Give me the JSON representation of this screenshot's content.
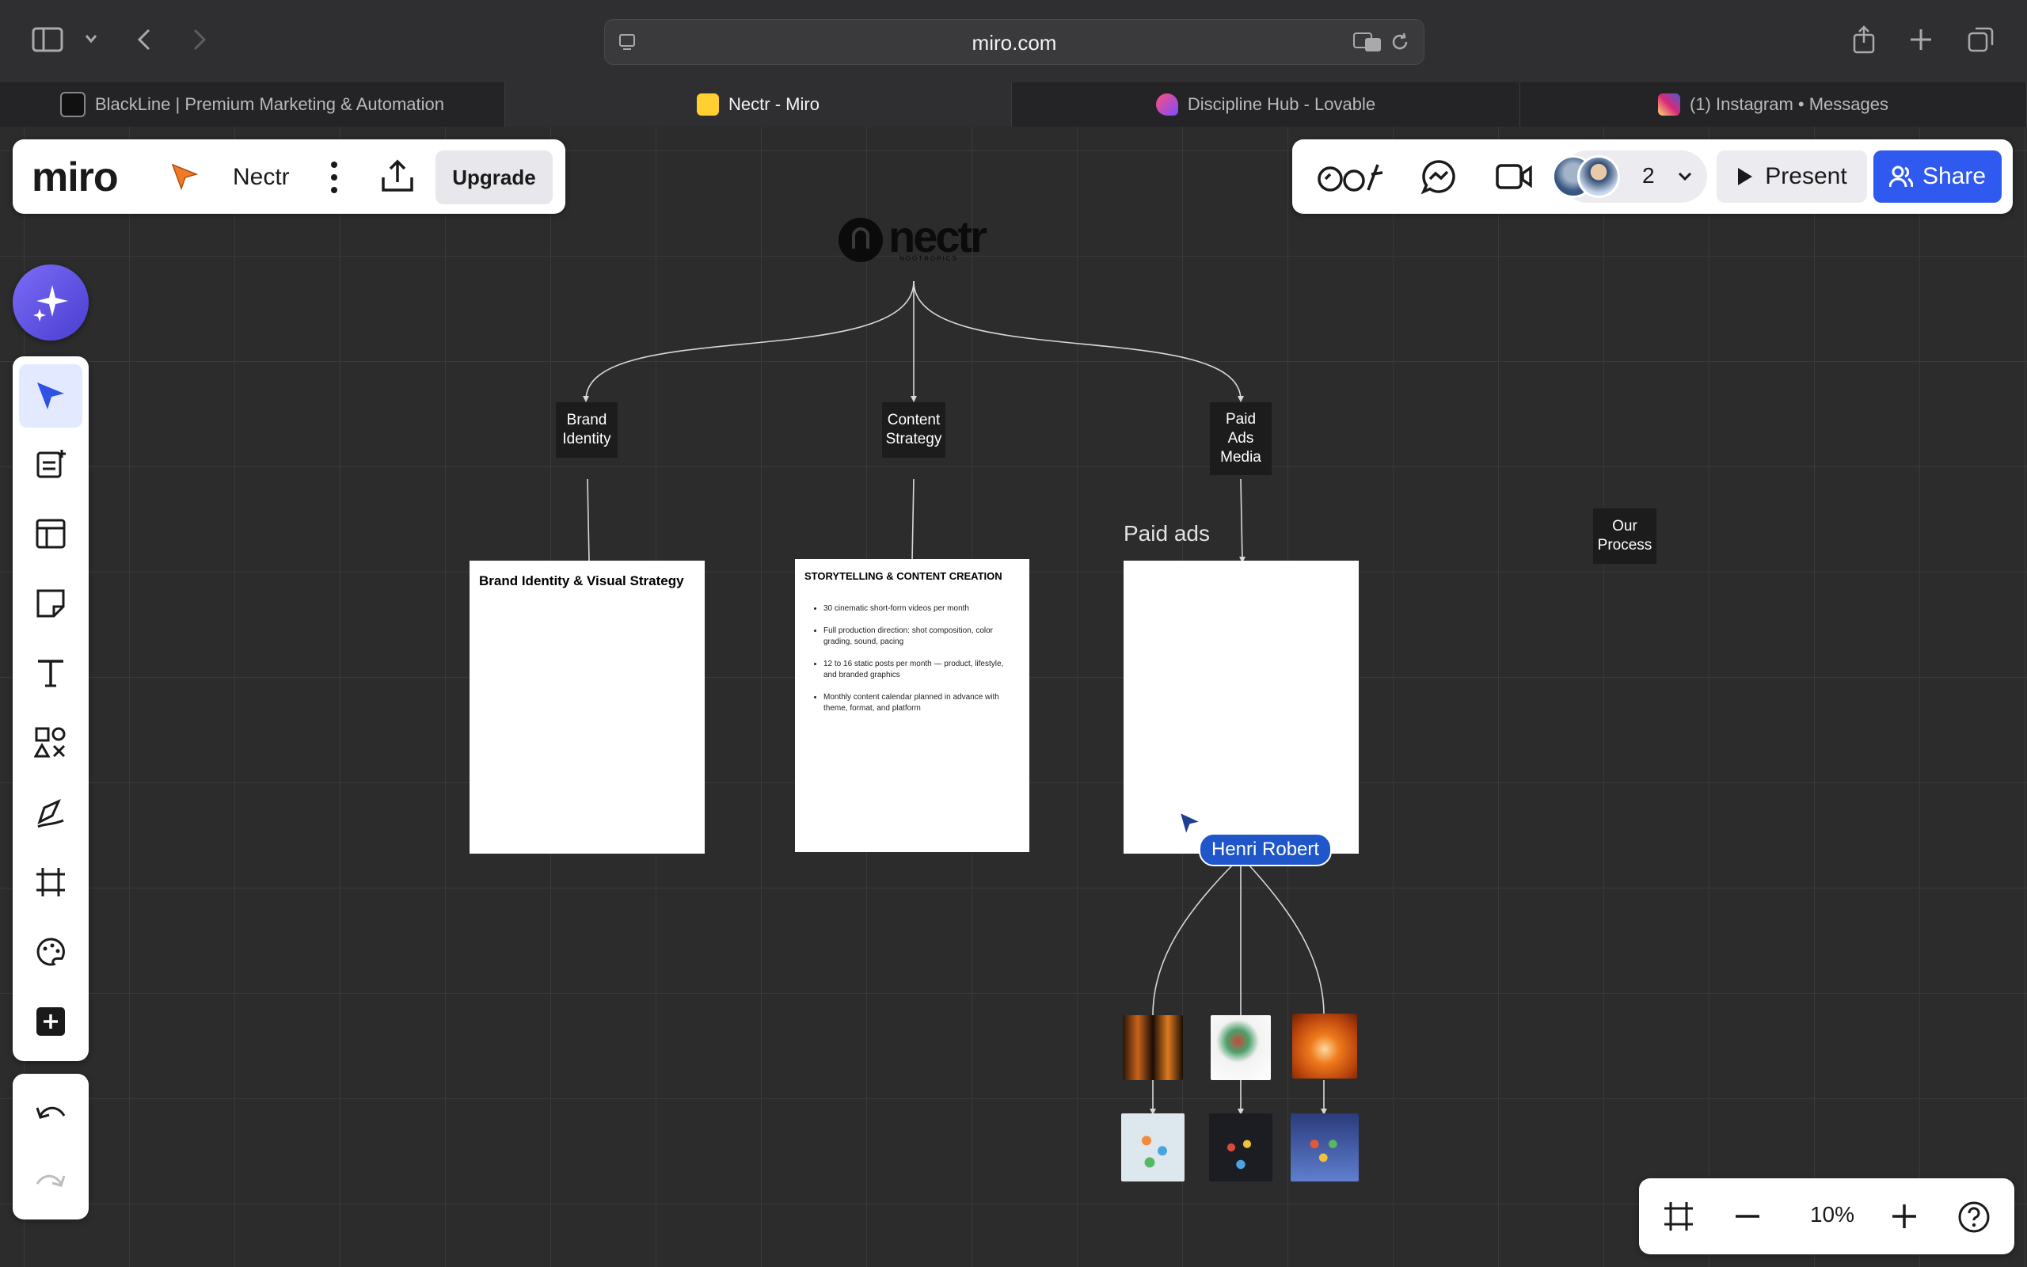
{
  "browser": {
    "url": "miro.com",
    "tabs": [
      {
        "title": "BlackLine | Premium Marketing & Automation",
        "favicon": "blackline-favicon",
        "active": false
      },
      {
        "title": "Nectr - Miro",
        "favicon": "miro-favicon",
        "active": true
      },
      {
        "title": "Discipline Hub - Lovable",
        "favicon": "lovable-favicon",
        "active": false
      },
      {
        "title": "(1) Instagram • Messages",
        "favicon": "instagram-favicon",
        "active": false
      }
    ]
  },
  "miro": {
    "logo": "miro",
    "board_name": "Nectr",
    "upgrade_label": "Upgrade",
    "collaborator_count": "2",
    "present_label": "Present",
    "share_label": "Share",
    "zoom": "10%",
    "accent": "#3059f0"
  },
  "board": {
    "brand_logo": "nectr",
    "brand_logo_sub": "NOOTROPICS",
    "nodes": {
      "brand_identity": "Brand\nIdentity",
      "content_strategy": "Content\nStrategy",
      "paid_ads_media": "Paid\nAds\nMedia",
      "our_process": "Our\nProcess"
    },
    "docs": {
      "brand_title": "Brand Identity & Visual Strategy",
      "content_title": "STORYTELLING & CONTENT CREATION",
      "content_bullets": [
        "30 cinematic short-form videos per month",
        "Full production direction: shot composition, color grading, sound, pacing",
        "12 to 16 static posts per month — product, lifestyle, and branded graphics",
        "Monthly content calendar planned in advance with theme, format, and platform"
      ]
    },
    "paid_ads_title": "Paid ads",
    "cursor_user": "Henri Robert"
  }
}
